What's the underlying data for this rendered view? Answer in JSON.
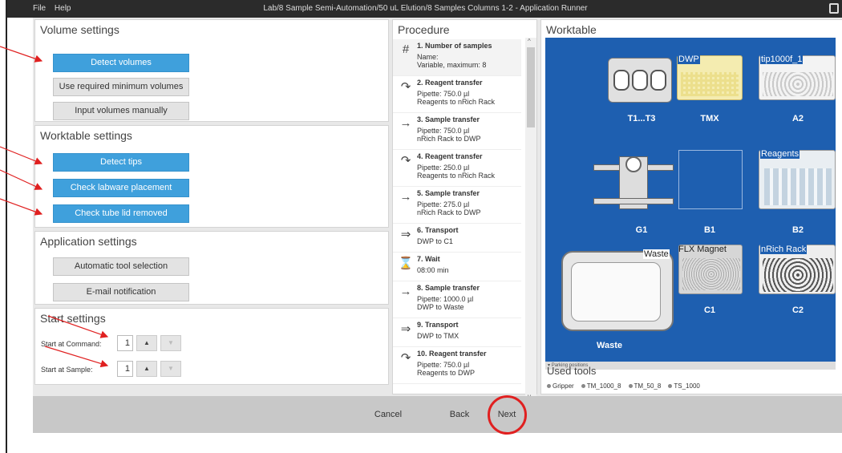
{
  "titlebar": {
    "menu": [
      "File",
      "Help"
    ],
    "title": "Lab/8 Sample Semi-Automation/50 uL Elution/8 Samples Columns 1-2 - Application Runner"
  },
  "volume": {
    "title": "Volume settings",
    "detect": "Detect volumes",
    "minimum": "Use required minimum volumes",
    "manual": "Input volumes manually"
  },
  "worktable_settings": {
    "title": "Worktable settings",
    "detect_tips": "Detect tips",
    "labware": "Check labware placement",
    "tubelid": "Check tube lid removed"
  },
  "application": {
    "title": "Application settings",
    "tool": "Automatic tool selection",
    "email": "E-mail notification"
  },
  "start": {
    "title": "Start settings",
    "command_label": "Start at Command:",
    "command_value": "1",
    "sample_label": "Start at Sample:",
    "sample_value": "1"
  },
  "procedure": {
    "title": "Procedure",
    "steps": [
      {
        "icon": "#",
        "name": "1. Number of samples",
        "d1": "Name:",
        "d2": "Variable, maximum: 8"
      },
      {
        "icon": "↷",
        "name": "2. Reagent transfer",
        "d1": "Pipette: 750.0 µl",
        "d2": "Reagents to nRich Rack"
      },
      {
        "icon": "→",
        "name": "3. Sample transfer",
        "d1": "Pipette: 750.0 µl",
        "d2": "nRich Rack to DWP"
      },
      {
        "icon": "↷",
        "name": "4. Reagent transfer",
        "d1": "Pipette: 250.0 µl",
        "d2": "Reagents to nRich Rack"
      },
      {
        "icon": "→",
        "name": "5. Sample transfer",
        "d1": "Pipette: 275.0 µl",
        "d2": "nRich Rack to DWP"
      },
      {
        "icon": "⇒",
        "name": "6. Transport",
        "d1": "DWP to C1",
        "d2": ""
      },
      {
        "icon": "⌛",
        "name": "7. Wait",
        "d1": "08:00 min",
        "d2": ""
      },
      {
        "icon": "→",
        "name": "8. Sample transfer",
        "d1": "Pipette: 1000.0 µl",
        "d2": "DWP to Waste"
      },
      {
        "icon": "⇒",
        "name": "9. Transport",
        "d1": "DWP to TMX",
        "d2": ""
      },
      {
        "icon": "↷",
        "name": "10. Reagent transfer",
        "d1": "Pipette: 750.0 µl",
        "d2": "Reagents to DWP"
      }
    ]
  },
  "worktable": {
    "title": "Worktable",
    "positions": {
      "t": "T1...T3",
      "tmx": "TMX",
      "a2": "A2",
      "g1": "G1",
      "b1": "B1",
      "b2": "B2",
      "c1": "C1",
      "c2": "C2",
      "waste": "Waste"
    },
    "labware": {
      "dwp": "DWP",
      "tip": "tip1000f_1",
      "reagents": "Reagents",
      "waste": "Waste",
      "flx": "FLX Magnet",
      "nrich": "nRich Rack"
    },
    "parking": "Parking positions"
  },
  "used_tools": {
    "title": "Used tools",
    "items": [
      "Gripper",
      "TM_1000_8",
      "TM_50_8",
      "TS_1000"
    ]
  },
  "footer": {
    "cancel": "Cancel",
    "back": "Back",
    "next": "Next"
  },
  "colors": {
    "accent_blue": "#3fa0dc",
    "worktable_blue": "#1e5fb0",
    "annotation_red": "#e02020"
  }
}
